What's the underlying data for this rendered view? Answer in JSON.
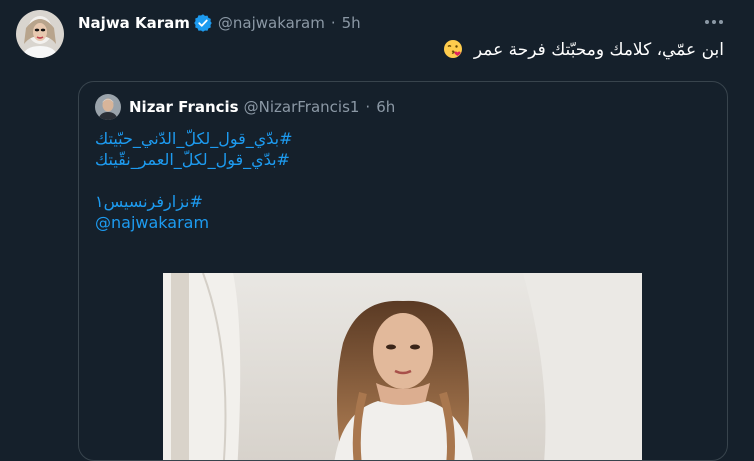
{
  "tweet": {
    "author_name": "Najwa Karam",
    "author_handle": "@najwakaram",
    "separator": "·",
    "time": "5h",
    "text": "ابن عمّي، كلامك ومحبّتك فرحة عمر",
    "emoji": "face-blowing-kiss-icon"
  },
  "quoted": {
    "author_name": "Nizar Francis",
    "author_handle": "@NizarFrancis1",
    "separator": "·",
    "time": "6h",
    "lines": [
      "#بدّي_قول_لكلّ_الدّني_حبّيتك",
      "#بدّي_قول_لكلّ_العمر_نقّيتك",
      "#نزارفرنسيس١"
    ],
    "mention": "@najwakaram"
  },
  "colors": {
    "background": "#15202b",
    "border": "#38444d",
    "secondary_text": "#8b98a5",
    "link": "#1d9bf0",
    "verified": "#1d9bf0"
  }
}
